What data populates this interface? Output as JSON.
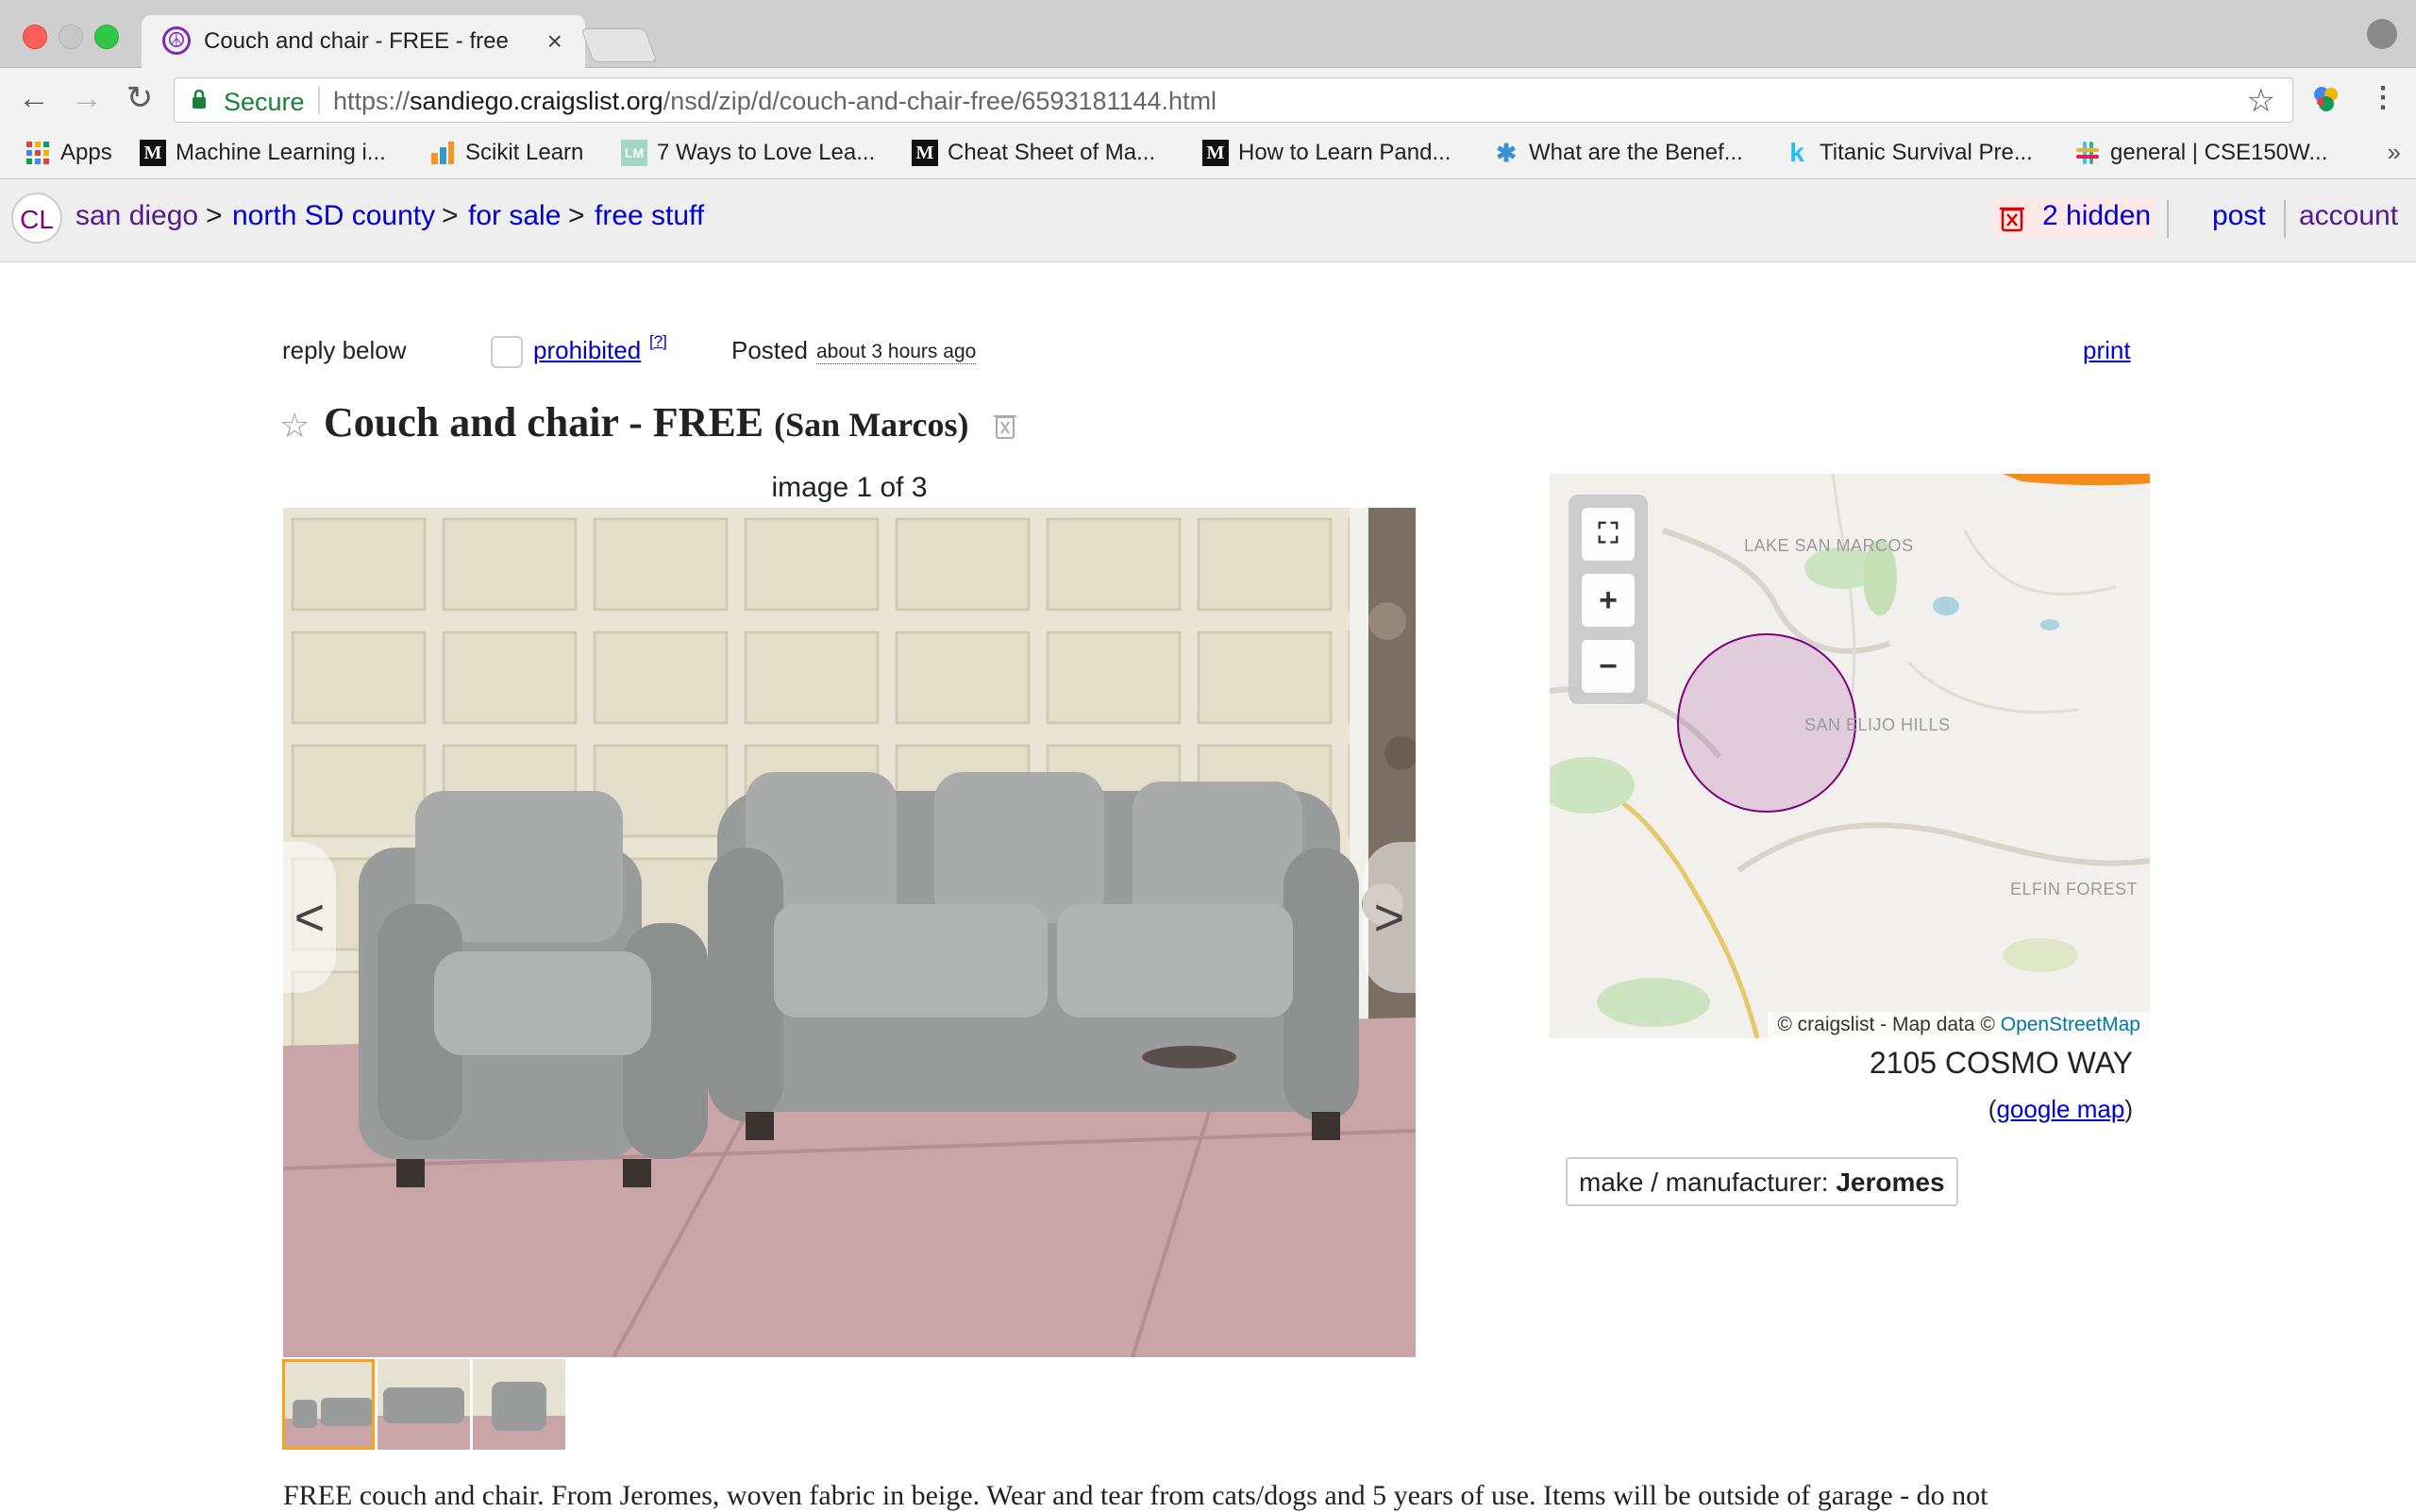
{
  "browser": {
    "tab_title": "Couch and chair - FREE - free",
    "tab_close": "×",
    "secure_label": "Secure",
    "url_scheme": "https://",
    "url_host": "sandiego.craigslist.org",
    "url_path": "/nsd/zip/d/couch-and-chair-free/6593181144.html",
    "bookmarks": [
      {
        "label": "Apps",
        "icon": "apps-grid-icon"
      },
      {
        "label": "Machine Learning i...",
        "icon": "medium-icon"
      },
      {
        "label": "Scikit Learn",
        "icon": "chart-icon"
      },
      {
        "label": "7 Ways to Love Lea...",
        "icon": "lm-icon"
      },
      {
        "label": "Cheat Sheet of Ma...",
        "icon": "medium-icon"
      },
      {
        "label": "How to Learn Pand...",
        "icon": "medium-icon"
      },
      {
        "label": "What are the Benef...",
        "icon": "puzzle-icon"
      },
      {
        "label": "Titanic Survival Pre...",
        "icon": "kaggle-icon"
      },
      {
        "label": "general | CSE150W...",
        "icon": "slack-icon"
      }
    ],
    "bookmarks_more": "»"
  },
  "craigslist_header": {
    "logo": "CL",
    "crumbs": [
      "san diego",
      "north SD county",
      "for sale",
      "free stuff"
    ],
    "crumb_sep": ">",
    "hidden_label": "2 hidden",
    "post_label": "post",
    "account_label": "account"
  },
  "posting": {
    "reply_label": "reply below",
    "prohibited_label": "prohibited",
    "prohibited_help": "[?]",
    "posted_label": "Posted",
    "posted_time": "about 3 hours ago",
    "print_label": "print",
    "title": "Couch and chair - FREE",
    "location": "(San Marcos)",
    "image_counter": "image 1 of 3",
    "prev_arrow": "<",
    "next_arrow": ">",
    "description": "FREE couch and chair. From Jeromes, woven fabric in beige. Wear and tear from cats/dogs and 5 years of use. Items will be outside of garage - do not"
  },
  "map": {
    "labels": [
      "LAKE SAN MARCOS",
      "SAN ELIJO HILLS",
      "ELFIN FOREST"
    ],
    "fullscreen": "⛶",
    "zoom_in": "+",
    "zoom_out": "−",
    "attribution_prefix": "© craigslist - Map data ©",
    "attribution_osm": "OpenStreetMap",
    "address": "2105 COSMO WAY",
    "google_map_label": "google map",
    "circle_color": "#800080"
  },
  "attributes": {
    "label": "make / manufacturer:",
    "value": "Jeromes"
  }
}
